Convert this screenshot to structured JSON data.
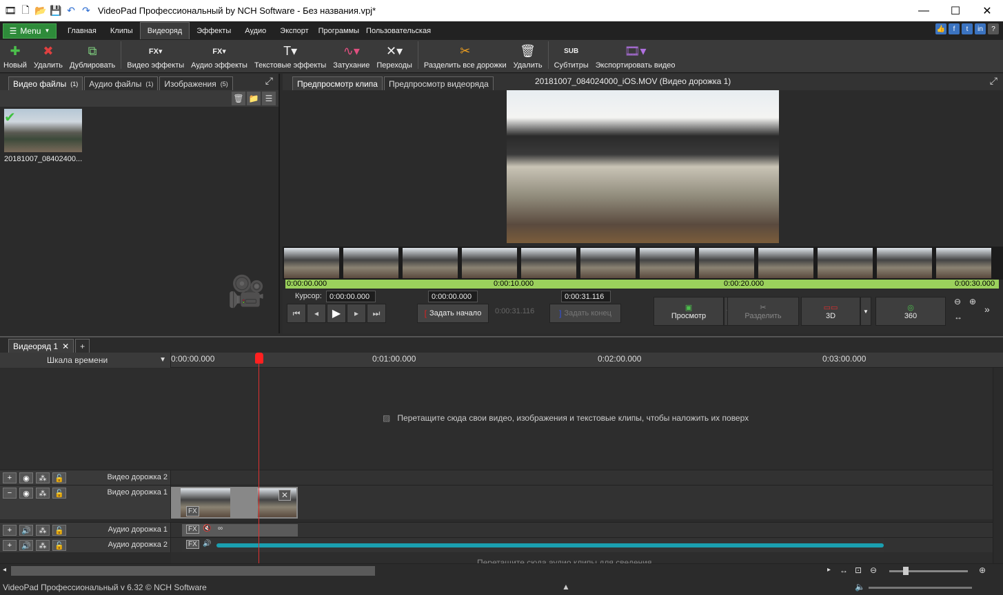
{
  "window": {
    "title": "VideoPad Профессиональный by NCH Software - Без названия.vpj*",
    "minimize": "—",
    "maximize": "☐",
    "close": "✕"
  },
  "menubar": {
    "menu_label": "Menu",
    "tabs": [
      "Главная",
      "Клипы",
      "Видеоряд",
      "Эффекты",
      "Аудио",
      "Экспорт",
      "Программы",
      "Пользовательская"
    ],
    "active_tab": "Видеоряд"
  },
  "toolbar": {
    "buttons": [
      {
        "label": "Новый",
        "icon": "add-clip-icon"
      },
      {
        "label": "Удалить",
        "icon": "delete-clip-icon"
      },
      {
        "label": "Дублировать",
        "icon": "duplicate-icon"
      },
      {
        "label": "Видео эффекты",
        "icon": "video-fx-icon"
      },
      {
        "label": "Аудио эффекты",
        "icon": "audio-fx-icon"
      },
      {
        "label": "Текстовые эффекты",
        "icon": "text-fx-icon"
      },
      {
        "label": "Затухание",
        "icon": "fade-icon"
      },
      {
        "label": "Переходы",
        "icon": "transition-icon"
      },
      {
        "label": "Разделить все дорожки",
        "icon": "scissors-icon"
      },
      {
        "label": "Удалить",
        "icon": "trash-icon"
      },
      {
        "label": "Субтитры",
        "icon": "subtitles-icon"
      },
      {
        "label": "Экспортировать видео",
        "icon": "export-icon"
      }
    ]
  },
  "media_panel": {
    "tabs": [
      {
        "label": "Видео файлы",
        "count": "(1)"
      },
      {
        "label": "Аудио файлы",
        "count": "(1)"
      },
      {
        "label": "Изображения",
        "count": "(5)"
      }
    ],
    "clip_label": "20181007_08402400..."
  },
  "preview": {
    "tabs": [
      "Предпросмотр клипа",
      "Предпросмотр видеоряда"
    ],
    "clip_title": "20181007_084024000_iOS.MOV (Видео дорожка 1)",
    "ruler_ticks": [
      "0:00:00.000",
      "0:00:10.000",
      "0:00:20.000",
      "0:00:30.000"
    ],
    "cursor_label": "Курсор:",
    "cursor_value": "0:00:00.000",
    "start_value": "0:00:00.000",
    "duration_value": "0:00:31.116",
    "end_value": "0:00:31.116",
    "set_start": "Задать начало",
    "set_end": "Задать конец",
    "preview_btn": "Просмотр",
    "split_btn": "Разделить",
    "btn_3d": "3D",
    "btn_360": "360"
  },
  "sequence": {
    "tab_label": "Видеоряд 1",
    "add_tab": "+",
    "scale_label": "Шкала времени",
    "ticks": [
      "0:00:00.000",
      "0:01:00.000",
      "0:02:00.000",
      "0:03:00.000"
    ],
    "overlay_message": "Перетащите сюда свои видео, изображения и текстовые клипы, чтобы наложить их поверх",
    "tracks": [
      {
        "name": "Видео дорожка 2"
      },
      {
        "name": "Видео дорожка 1"
      },
      {
        "name": "Аудио дорожка 1"
      },
      {
        "name": "Аудио дорожка 2"
      }
    ],
    "audio_drop_message": "Перетащите сюда аудио клипы для сведения"
  },
  "statusbar": {
    "text": "VideoPad Профессиональный v 6.32 © NCH Software"
  },
  "colors": {
    "accent_green": "#2e8b3a",
    "ruler_green": "#9bd15c",
    "playhead": "#e03030",
    "waveform": "#1a9fb0"
  }
}
